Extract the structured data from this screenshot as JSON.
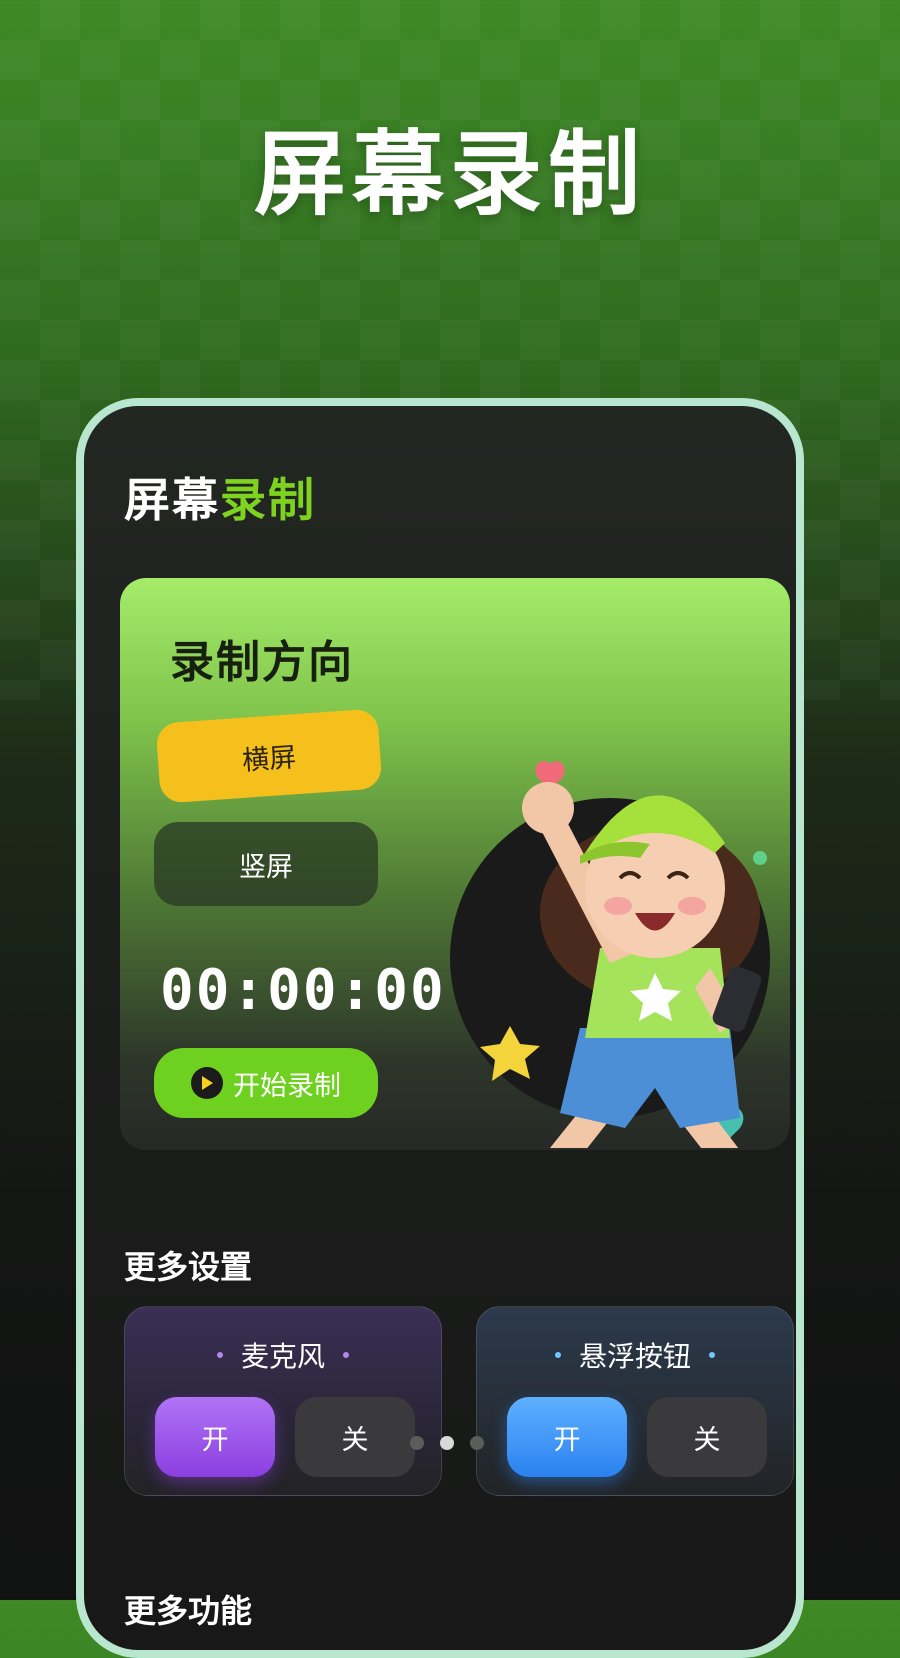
{
  "promo": {
    "title": "屏幕录制"
  },
  "app": {
    "title_white": "屏幕",
    "title_green": "录制"
  },
  "record_card": {
    "heading": "录制方向",
    "orientation_options": [
      "横屏",
      "竖屏"
    ],
    "selected_orientation": "横屏",
    "timer": "00:00:00",
    "start_label": "开始录制"
  },
  "more_settings": {
    "heading": "更多设置",
    "microphone": {
      "label": "麦克风",
      "on_label": "开",
      "off_label": "关"
    },
    "floating_button": {
      "label": "悬浮按钮",
      "on_label": "开",
      "off_label": "关"
    }
  },
  "pager": {
    "count": 3,
    "active_index": 1
  },
  "more_functions": {
    "heading": "更多功能"
  },
  "colors": {
    "accent_green": "#7ed321",
    "start_green": "#6fd11f",
    "landscape_yellow": "#f5c01b",
    "purple_on": "#8b3fe0",
    "blue_on": "#2a82f0",
    "phone_border": "#b8e6cf"
  },
  "icons": {
    "start": "play-icon"
  }
}
